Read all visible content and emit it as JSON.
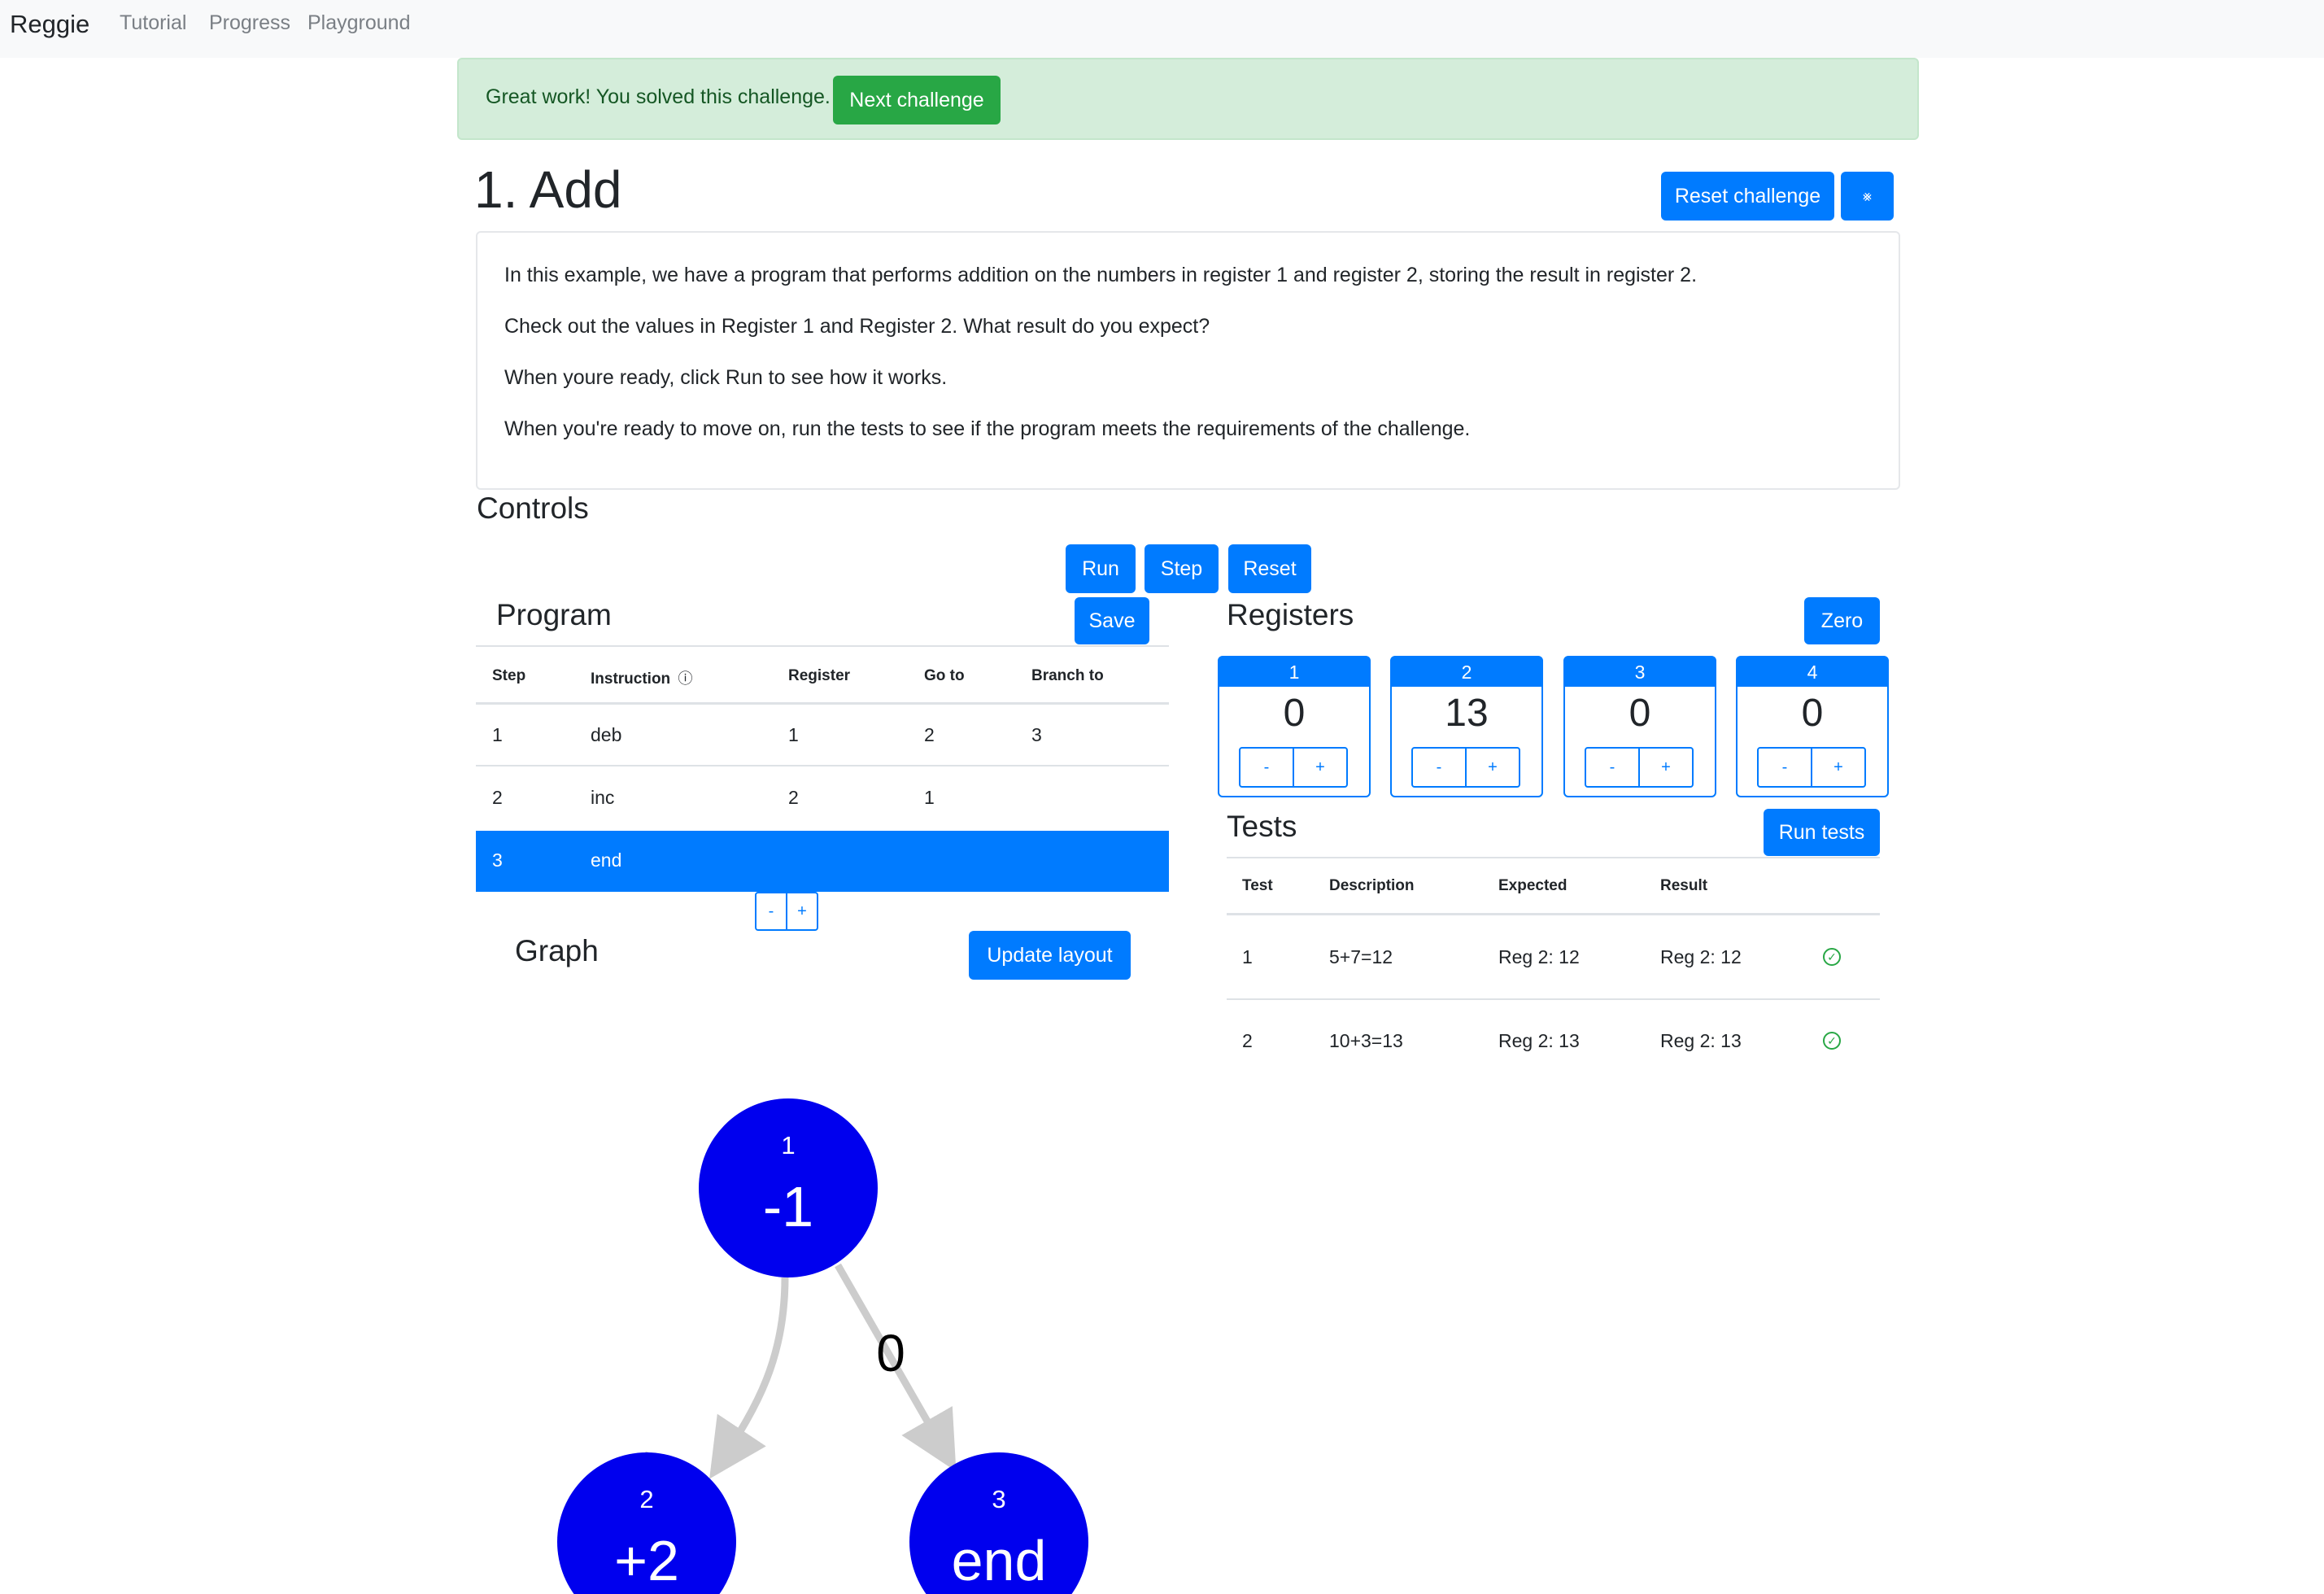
{
  "nav": {
    "brand": "Reggie",
    "links": [
      "Tutorial",
      "Progress",
      "Playground"
    ]
  },
  "alert": {
    "message": "Great work! You solved this challenge.",
    "next_label": "Next challenge"
  },
  "challenge": {
    "title": "1. Add",
    "reset_label": "Reset challenge",
    "collapse_icon": "⨳",
    "description": [
      "In this example, we have a program that performs addition on the numbers in register 1 and register 2, storing the result in register 2.",
      "Check out the values in Register 1 and Register 2. What result do you expect?",
      "When youre ready, click Run to see how it works.",
      "When you're ready to move on, run the tests to see if the program meets the requirements of the challenge."
    ]
  },
  "controls": {
    "title": "Controls",
    "run": "Run",
    "step": "Step",
    "reset": "Reset"
  },
  "program": {
    "title": "Program",
    "save": "Save",
    "headers": [
      "Step",
      "Instruction",
      "Register",
      "Go to",
      "Branch to"
    ],
    "info_icon": "ⓘ",
    "rows": [
      [
        "1",
        "deb",
        "1",
        "2",
        "3"
      ],
      [
        "2",
        "inc",
        "2",
        "1",
        ""
      ],
      [
        "3",
        "end",
        "",
        "",
        ""
      ]
    ],
    "selected_row": 3,
    "minus": "-",
    "plus": "+"
  },
  "registers": {
    "title": "Registers",
    "zero": "Zero",
    "items": [
      {
        "label": "1",
        "value": "0"
      },
      {
        "label": "2",
        "value": "13"
      },
      {
        "label": "3",
        "value": "0"
      },
      {
        "label": "4",
        "value": "0"
      }
    ],
    "minus": "-",
    "plus": "+"
  },
  "tests": {
    "title": "Tests",
    "run": "Run tests",
    "headers": [
      "Test",
      "Description",
      "Expected",
      "Result"
    ],
    "rows": [
      [
        "1",
        "5+7=12",
        "Reg 2: 12",
        "Reg 2: 12"
      ],
      [
        "2",
        "10+3=13",
        "Reg 2: 13",
        "Reg 2: 13"
      ]
    ],
    "pass_icon": "✓"
  },
  "graph": {
    "title": "Graph",
    "update": "Update layout",
    "nodes": [
      {
        "id": "1",
        "label": "-1"
      },
      {
        "id": "2",
        "label": "+2"
      },
      {
        "id": "3",
        "label": "end"
      }
    ],
    "edge_label": "0",
    "colors": {
      "node": "#0000ee",
      "edge": "#cccccc"
    }
  },
  "colors": {
    "primary": "#007bff",
    "success": "#28a745",
    "alert_bg": "#d4edda"
  }
}
